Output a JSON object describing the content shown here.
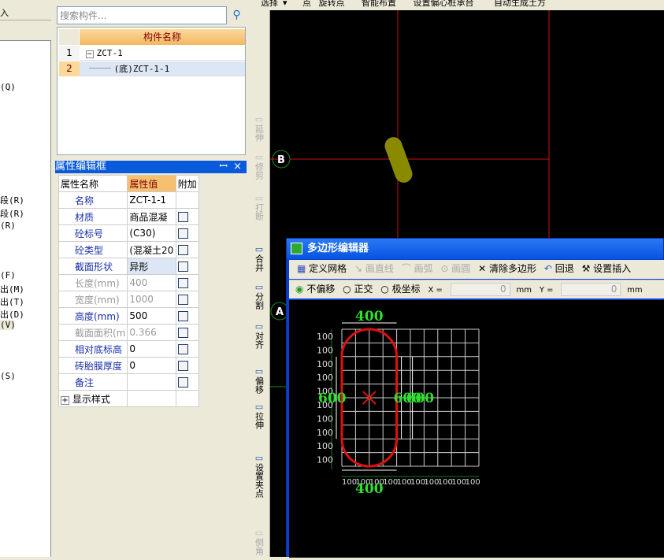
{
  "left_menu": {
    "items": [
      "入",
      "(Q)",
      "段(R)",
      "段(R)",
      "(R)",
      "(F)",
      "出(M)",
      "出(T)",
      "出(D)",
      "(V)",
      "(S)"
    ]
  },
  "component_panel": {
    "search_placeholder": "搜索构件...",
    "column_header": "构件名称",
    "rows": [
      {
        "index": "1",
        "name": "ZCT-1"
      },
      {
        "index": "2",
        "name": "(底)ZCT-1-1"
      }
    ]
  },
  "property_panel": {
    "title": "属性编辑框",
    "headers": [
      "属性名称",
      "属性值",
      "附加"
    ],
    "rows": [
      {
        "name": "名称",
        "value": "ZCT-1-1",
        "check": false,
        "disabled": false
      },
      {
        "name": "材质",
        "value": "商品混凝",
        "check": true,
        "disabled": false
      },
      {
        "name": "砼标号",
        "value": "(C30)",
        "check": true,
        "disabled": false
      },
      {
        "name": "砼类型",
        "value": "(混凝土20",
        "check": true,
        "disabled": false
      },
      {
        "name": "截面形状",
        "value": "异形",
        "check": true,
        "disabled": false
      },
      {
        "name": "长度(mm)",
        "value": "400",
        "check": true,
        "disabled": true
      },
      {
        "name": "宽度(mm)",
        "value": "1000",
        "check": true,
        "disabled": true
      },
      {
        "name": "高度(mm)",
        "value": "500",
        "check": true,
        "disabled": false
      },
      {
        "name": "截面面积(m",
        "value": "0.366",
        "check": true,
        "disabled": true
      },
      {
        "name": "相对底标高",
        "value": "0",
        "check": true,
        "disabled": false
      },
      {
        "name": "砖胎膜厚度",
        "value": "0",
        "check": true,
        "disabled": false
      },
      {
        "name": "备注",
        "value": "",
        "check": true,
        "disabled": false
      }
    ],
    "group": "显示样式"
  },
  "top_toolbar": {
    "items": [
      "选择",
      "点",
      "旋转点",
      "智能布置",
      "设置偏心桩承台",
      "自动生成土方"
    ]
  },
  "vertical_toolbar": {
    "items": [
      {
        "label": "延伸",
        "disabled": true
      },
      {
        "label": "修剪",
        "disabled": true
      },
      {
        "label": "打断",
        "disabled": true
      },
      {
        "label": "合并",
        "disabled": false
      },
      {
        "label": "分割",
        "disabled": false
      },
      {
        "label": "对齐",
        "disabled": false
      },
      {
        "label": "偏移",
        "disabled": false
      },
      {
        "label": "拉伸",
        "disabled": false
      },
      {
        "label": "设置夹点",
        "disabled": false
      },
      {
        "label": "倒角",
        "disabled": true
      }
    ]
  },
  "canvas": {
    "axis_labels": [
      "B",
      "A"
    ]
  },
  "polygon_editor": {
    "title": "多边形编辑器",
    "toolbar": [
      "定义网格",
      "画直线",
      "画弧",
      "画圆",
      "清除多边形",
      "回退",
      "设置插入"
    ],
    "modes": [
      "不偏移",
      "正交",
      "极坐标"
    ],
    "selected_mode": "不偏移",
    "x_label": "X =",
    "x_value": "0",
    "x_unit": "mm",
    "y_label": "Y =",
    "y_value": "0",
    "y_unit": "mm",
    "dims": {
      "top": "400",
      "bottom": "400",
      "left": "600",
      "right": "600",
      "grid_step": "100"
    }
  }
}
